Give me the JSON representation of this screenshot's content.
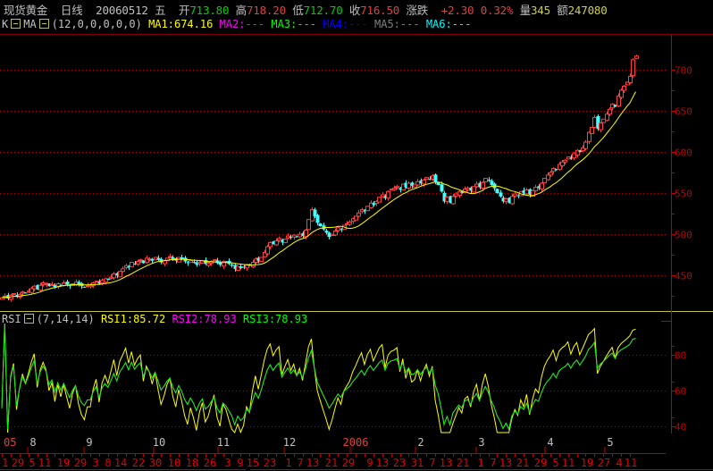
{
  "header": {
    "name": "现货黄金",
    "period": "日线",
    "date": "20060512",
    "weekday": "五",
    "open_label": "开",
    "open": "713.80",
    "high_label": "高",
    "high": "718.20",
    "low_label": "低",
    "low": "712.70",
    "close_label": "收",
    "close": "716.50",
    "change_label": "涨跌",
    "change": "+2.30",
    "change_pct": "0.32%",
    "volume_label": "量",
    "volume": "345",
    "amount_label": "额",
    "amount": "247080"
  },
  "ma_legend": {
    "k": "K",
    "name": "MA",
    "params": "(12,0,0,0,0,0)",
    "ma1": "MA1:674.16",
    "ma2": "MA2:---",
    "ma3": "MA3:---",
    "ma4": "MA4:---",
    "ma5": "MA5:---",
    "ma6": "MA6:---"
  },
  "rsi_legend": {
    "name": "RSI",
    "params": "(7,14,14)",
    "rsi1": "RSI1:85.72",
    "rsi2": "RSI2:78.93",
    "rsi3": "RSI3:78.93"
  },
  "colors": {
    "up": "#ff4040",
    "down": "#40ffff",
    "ma1": "#ffff00",
    "rsi1": "#ffff00",
    "rsi2": "#ff00ff",
    "rsi3": "#00ff00",
    "axis": "#c00000",
    "border": "#c0c040"
  },
  "chart_data": [
    {
      "type": "candlestick",
      "title": "现货黄金 日线",
      "y_ticks": [
        450,
        500,
        550,
        600,
        650,
        700
      ],
      "ylim": [
        415,
        725
      ],
      "ma_period": 12,
      "last_candle": {
        "open": 713.8,
        "high": 718.2,
        "low": 712.7,
        "close": 716.5
      },
      "closes": [
        423,
        425,
        422,
        426,
        428,
        424,
        427,
        430,
        429,
        431,
        434,
        437,
        433,
        438,
        441,
        440,
        437,
        439,
        436,
        440,
        438,
        441,
        439,
        437,
        440,
        442,
        439,
        437,
        436,
        438,
        438,
        441,
        443,
        440,
        444,
        446,
        445,
        448,
        452,
        450,
        455,
        458,
        462,
        460,
        466,
        464,
        467,
        469,
        465,
        471,
        470,
        468,
        472,
        469,
        466,
        468,
        471,
        473,
        470,
        468,
        472,
        470,
        467,
        465,
        468,
        466,
        463,
        466,
        468,
        464,
        465,
        467,
        469,
        465,
        463,
        467,
        466,
        464,
        462,
        458,
        461,
        459,
        460,
        463,
        462,
        466,
        470,
        468,
        472,
        478,
        485,
        490,
        488,
        492,
        495,
        490,
        494,
        498,
        496,
        499,
        497,
        500,
        498,
        505,
        518,
        530,
        522,
        514,
        510,
        506,
        502,
        497,
        500,
        504,
        508,
        506,
        511,
        513,
        515,
        519,
        522,
        526,
        530,
        528,
        534,
        538,
        536,
        540,
        545,
        548,
        544,
        552,
        555,
        556,
        558,
        554,
        561,
        557,
        562,
        559,
        560,
        564,
        562,
        566,
        569,
        567,
        571,
        564,
        560,
        552,
        540,
        545,
        538,
        546,
        549,
        552,
        550,
        555,
        556,
        553,
        558,
        561,
        557,
        563,
        568,
        565,
        560,
        556,
        550,
        546,
        540,
        543,
        538,
        546,
        549,
        547,
        552,
        550,
        554,
        548,
        553,
        557,
        556,
        562,
        568,
        572,
        575,
        580,
        578,
        585,
        588,
        590,
        594,
        592,
        598,
        602,
        600,
        605,
        612,
        624,
        630,
        642,
        628,
        635,
        640,
        646,
        652,
        658,
        655,
        668,
        675,
        680,
        685,
        692,
        712,
        716.5
      ]
    },
    {
      "type": "line",
      "title": "RSI",
      "periods": [
        7,
        14,
        14
      ],
      "series": [
        "RSI1",
        "RSI2",
        "RSI3"
      ],
      "y_ticks": [
        40,
        60,
        80
      ],
      "ylim": [
        26,
        94
      ]
    }
  ],
  "x_axis": {
    "months": [
      "05",
      "8",
      "9",
      "10",
      "11",
      "12",
      "2006",
      "2",
      "3",
      "4",
      "5"
    ],
    "days": [
      "1",
      "29",
      "5",
      "11",
      "19",
      "29",
      "3",
      "8",
      "14",
      "22",
      "30",
      "10",
      "18",
      "26",
      "3",
      "9",
      "15",
      "23",
      "1",
      "7",
      "13",
      "21",
      "29",
      "9",
      "13",
      "23",
      "31",
      "7",
      "13",
      "21",
      "1",
      "7",
      "13",
      "21",
      "29",
      "5",
      "11",
      "19",
      "27",
      "4",
      "11"
    ]
  }
}
